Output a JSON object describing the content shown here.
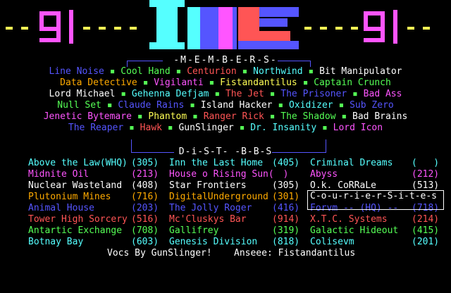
{
  "header": {
    "left_logo": "-9|-",
    "right_logo": "-9|-",
    "dashes": "- - - - -"
  },
  "members_title": "-M-E-M-B-E-R-S-",
  "members": [
    [
      {
        "name": "Line Noise",
        "color": "#5555ff"
      },
      {
        "name": "Cool Hand",
        "color": "#55ff55"
      },
      {
        "name": "Centurion",
        "color": "#ff5555"
      },
      {
        "name": "Northwind",
        "color": "#55ffff"
      },
      {
        "name": "Bit Manipulator",
        "color": "#ffffff"
      }
    ],
    [
      {
        "name": "Data Detective",
        "color": "#ffaa00"
      },
      {
        "name": "Vigilanti",
        "color": "#ff55ff"
      },
      {
        "name": "Fistandantilus",
        "color": "#ffff55"
      },
      {
        "name": "Captain Crunch",
        "color": "#55ff55"
      }
    ],
    [
      {
        "name": "Lord Michael",
        "color": "#ffffff"
      },
      {
        "name": "Gehenna Defjam",
        "color": "#55ffff"
      },
      {
        "name": "The Jet",
        "color": "#ff5555"
      },
      {
        "name": "The Prisoner",
        "color": "#5555ff"
      },
      {
        "name": "Bad Ass",
        "color": "#ff55ff"
      }
    ],
    [
      {
        "name": "Null Set",
        "color": "#55ff55"
      },
      {
        "name": "Claude Rains",
        "color": "#5555ff"
      },
      {
        "name": "Island Hacker",
        "color": "#ffffff"
      },
      {
        "name": "Oxidizer",
        "color": "#55ffff"
      },
      {
        "name": "Sub Zero",
        "color": "#5555ff"
      }
    ],
    [
      {
        "name": "Jenetic Bytemare",
        "color": "#ff55ff"
      },
      {
        "name": "Phantom",
        "color": "#ffff55"
      },
      {
        "name": "Ranger Rick",
        "color": "#ff5555"
      },
      {
        "name": "The Shadow",
        "color": "#55ff55"
      },
      {
        "name": "Bad Brains",
        "color": "#ffffff"
      }
    ],
    [
      {
        "name": "The Reaper",
        "color": "#5555ff"
      },
      {
        "name": "Hawk",
        "color": "#ff5555"
      },
      {
        "name": "GunSlinger",
        "color": "#ffffff"
      },
      {
        "name": "Dr. Insanity",
        "color": "#55ffff"
      },
      {
        "name": "Lord Icon",
        "color": "#ff55ff"
      }
    ]
  ],
  "dist_title": "D-i-S-T- -B-B-S",
  "courier_title": "C-o-u-r-i-e-r-S-i-t-e-s",
  "boards": [
    [
      {
        "name": "Above the Law(WHQ)",
        "num": "(305)",
        "color": "#55ffff"
      },
      {
        "name": "Inn the Last Home",
        "num": "(405)",
        "color": "#55ffff"
      },
      {
        "name": "Criminal Dreams",
        "num": "(   )",
        "color": "#55ffff"
      }
    ],
    [
      {
        "name": "Midnite Oil",
        "num": "(213)",
        "color": "#ff55ff"
      },
      {
        "name": "House o Rising Sun(",
        "num": "  )",
        "color": "#ff55ff"
      },
      {
        "name": "Abyss",
        "num": "(212)",
        "color": "#ff55ff"
      }
    ],
    [
      {
        "name": "Nuclear Wasteland",
        "num": "(408)",
        "color": "#ffffff"
      },
      {
        "name": "Star Frontiers",
        "num": "(305)",
        "color": "#ffffff"
      },
      {
        "name": "O.k. CoRRaLe",
        "num": "(513)",
        "color": "#ffffff"
      }
    ],
    [
      {
        "name": "Plutonium Mines",
        "num": "(716)",
        "color": "#ffaa00"
      },
      {
        "name": "DigitalUnderground",
        "num": "(301)",
        "color": "#ffaa00"
      },
      {
        "name": "",
        "num": "",
        "color": "#ffaa00"
      }
    ],
    [
      {
        "name": "Animal House",
        "num": "(203)",
        "color": "#5555ff"
      },
      {
        "name": "The Jolly Roger",
        "num": "(416)",
        "color": "#5555ff"
      },
      {
        "name": "Forvm -- (HQ) --",
        "num": "(718)",
        "color": "#5555ff"
      }
    ],
    [
      {
        "name": "Tower High Sorcery",
        "num": "(516)",
        "color": "#ff5555"
      },
      {
        "name": "Mc'Cluskys Bar",
        "num": "(914)",
        "color": "#ff5555"
      },
      {
        "name": "X.T.C. Systems",
        "num": "(214)",
        "color": "#ff5555"
      }
    ],
    [
      {
        "name": "Antartic Exchange",
        "num": "(708)",
        "color": "#55ff55"
      },
      {
        "name": "Gallifrey",
        "num": "(319)",
        "color": "#55ff55"
      },
      {
        "name": "Galactic Hideout",
        "num": "(415)",
        "color": "#55ff55"
      }
    ],
    [
      {
        "name": "Botnay Bay",
        "num": "(603)",
        "color": "#55ffff"
      },
      {
        "name": "Genesis Division",
        "num": "(818)",
        "color": "#55ffff"
      },
      {
        "name": "Colisevm",
        "num": "(201)",
        "color": "#55ffff"
      }
    ]
  ],
  "footer": {
    "vocs": "Vocs By GunSlinger!",
    "ansee": "Anseee: Fistandantilus"
  },
  "colors": {
    "background": "#000000",
    "logo_cyan": "#55ffff",
    "logo_blue": "#5555ff",
    "logo_red": "#ff5555",
    "logo_magenta": "#ff55ff",
    "logo_yellow": "#ffff55"
  }
}
